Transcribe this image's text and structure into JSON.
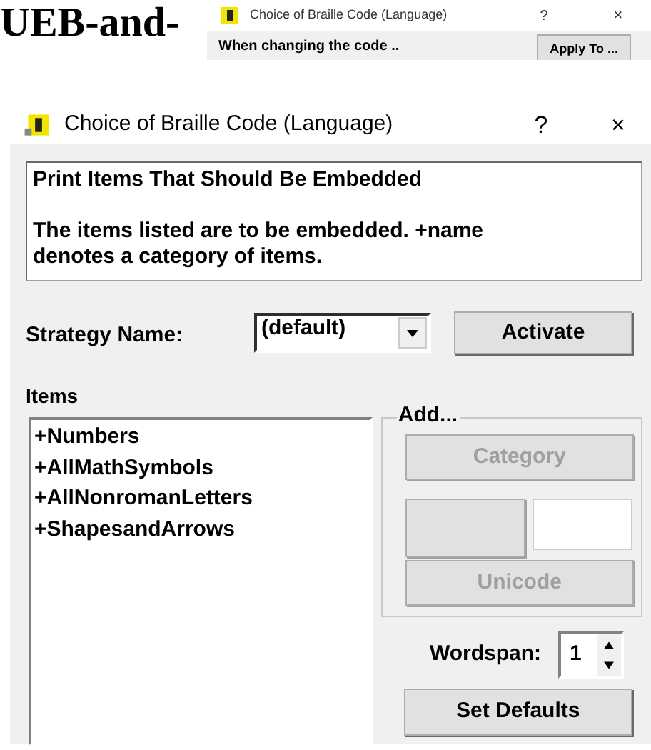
{
  "background_text": "UEB-and-",
  "background_window": {
    "title": "Choice of Braille Code (Language)",
    "help": "?",
    "close": "×",
    "message": "When changing the code ..",
    "button": "Apply To ..."
  },
  "window": {
    "title": "Choice of Braille Code (Language)",
    "help": "?",
    "close": "×"
  },
  "description": {
    "heading": "Print Items That Should Be Embedded",
    "body": "The items listed are to be embedded. +name denotes a category of items."
  },
  "strategy": {
    "label": "Strategy Name:",
    "value": "(default)",
    "button": "Activate"
  },
  "items": {
    "label": "Items",
    "entries": [
      "+Numbers",
      "+AllMathSymbols",
      "+AllNonromanLetters",
      "+ShapesandArrows"
    ]
  },
  "add_group": {
    "legend": "Add...",
    "category_button": {
      "label": "Category",
      "disabled": true
    },
    "blank_button": {
      "disabled": true
    },
    "unicode_button": {
      "label": "Unicode",
      "disabled": true
    }
  },
  "wordspan": {
    "label": "Wordspan:",
    "value": "1"
  },
  "buttons": [
    "Set Defaults"
  ]
}
